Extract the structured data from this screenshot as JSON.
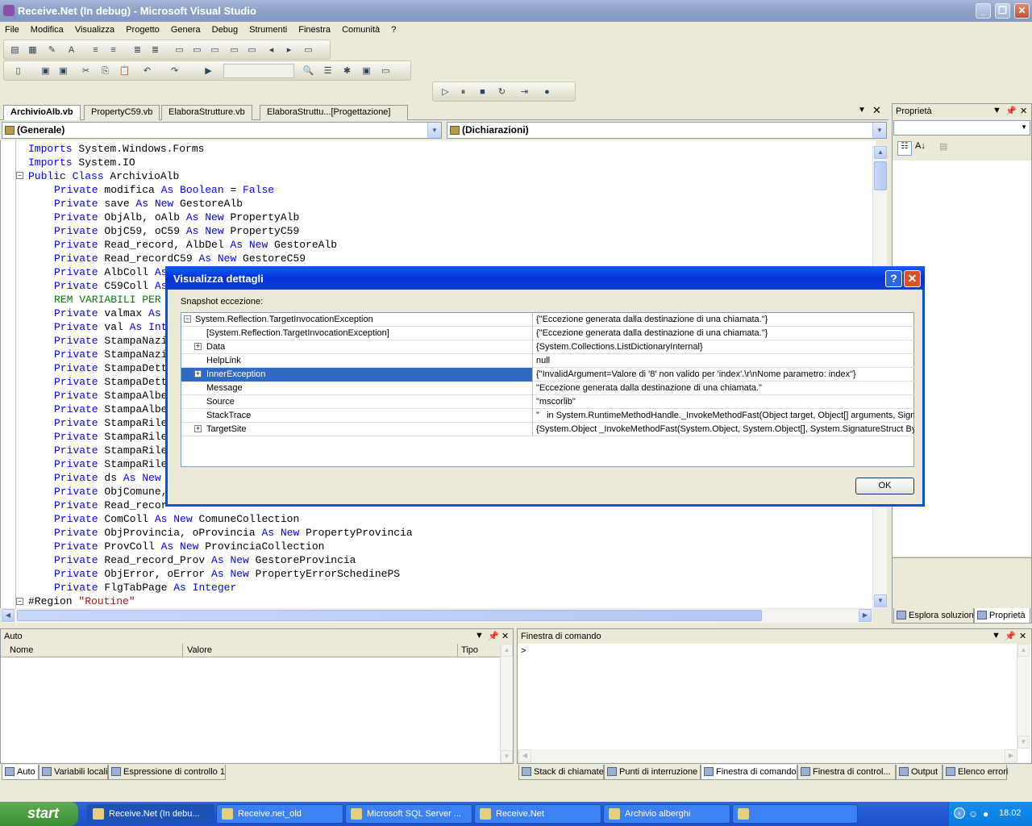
{
  "window": {
    "title": "Receive.Net (In debug) - Microsoft Visual Studio"
  },
  "menu": [
    "File",
    "Modifica",
    "Visualizza",
    "Progetto",
    "Genera",
    "Debug",
    "Strumenti",
    "Finestra",
    "Comunità",
    "?"
  ],
  "doc_tabs": [
    "ArchivioAlb.vb",
    "PropertyC59.vb",
    "ElaboraStrutture.vb",
    "ElaboraStruttu...[Progettazione]"
  ],
  "combos": {
    "left": "(Generale)",
    "right": "(Dichiarazioni)"
  },
  "code": {
    "l1": {
      "kw": "Imports",
      "rest": " System.Windows.Forms"
    },
    "l2": {
      "kw": "Imports",
      "rest": " System.IO"
    },
    "l3": {
      "kw": "Public Class",
      "rest": " ArchivioAlb"
    },
    "l4": {
      "rest1": " modifica ",
      "kw2": "As Boolean",
      "rest2": " = ",
      "kw3": "False"
    },
    "l5": {
      "rest1": " save ",
      "kw2": "As New",
      "rest2": " GestoreAlb"
    },
    "l6": {
      "rest1": " ObjAlb, oAlb ",
      "kw2": "As New",
      "rest2": " PropertyAlb"
    },
    "l7": {
      "rest1": " ObjC59, oC59 ",
      "kw2": "As New",
      "rest2": " PropertyC59"
    },
    "l8": {
      "rest1": " Read_record, AlbDel ",
      "kw2": "As New",
      "rest2": " GestoreAlb"
    },
    "l9": {
      "rest1": " Read_recordC59 ",
      "kw2": "As New",
      "rest2": " GestoreC59"
    },
    "l10": {
      "rest1": " AlbColl ",
      "kw2": "As"
    },
    "l11": {
      "rest1": " C59Coll ",
      "kw2": "As"
    },
    "l12": {
      "cm": "REM VARIABILI PER"
    },
    "l13": {
      "rest1": " valmax ",
      "kw2": "As"
    },
    "l14": {
      "rest1": " val ",
      "kw2": "As Int"
    },
    "l15": {
      "rest1": " StampaNazi"
    },
    "l16": {
      "rest1": " StampaNazi"
    },
    "l17": {
      "rest1": " StampaDett"
    },
    "l18": {
      "rest1": " StampaDett"
    },
    "l19": {
      "rest1": " StampaAlbe"
    },
    "l20": {
      "rest1": " StampaAlbe"
    },
    "l21": {
      "rest1": " StampaRile"
    },
    "l22": {
      "rest1": " StampaRile"
    },
    "l23": {
      "rest1": " StampaRile"
    },
    "l24": {
      "rest1": " StampaRile"
    },
    "l25": {
      "rest1": " ds ",
      "kw2": "As New"
    },
    "l26": {
      "rest1": " ObjComune,"
    },
    "l27": {
      "rest1": " Read_recor"
    },
    "l28": {
      "rest1": " ComColl ",
      "kw2": "As New",
      "rest2": " ComuneCollection"
    },
    "l29": {
      "rest1": " ObjProvincia, oProvincia ",
      "kw2": "As New",
      "rest2": " PropertyProvincia"
    },
    "l30": {
      "rest1": " ProvColl ",
      "kw2": "As New",
      "rest2": " ProvinciaCollection"
    },
    "l31": {
      "rest1": " Read_record_Prov ",
      "kw2": "As New",
      "rest2": " GestoreProvincia"
    },
    "l32": {
      "rest1": " ObjError, oError ",
      "kw2": "As New",
      "rest2": " PropertyErrorSchedinePS"
    },
    "l33": {
      "rest1": " FlgTabPage ",
      "kw2": "As Integer"
    },
    "l34": {
      "rest1": "#Region ",
      "str": "\"Routine\""
    },
    "private": "Private"
  },
  "properties_panel": {
    "title": "Proprietà",
    "tabs": [
      "Esplora soluzioni",
      "Proprietà"
    ]
  },
  "auto_panel": {
    "title": "Auto",
    "columns": [
      "Nome",
      "Valore",
      "Tipo"
    ]
  },
  "command_panel": {
    "title": "Finestra di comando",
    "prompt": ">"
  },
  "bottom_left_tabs": [
    "Auto",
    "Variabili locali",
    "Espressione di controllo 1"
  ],
  "bottom_right_tabs": [
    "Stack di chiamate",
    "Punti di interruzione",
    "Finestra di comando",
    "Finestra di control...",
    "Output",
    "Elenco errori"
  ],
  "dialog": {
    "title": "Visualizza dettagli",
    "label": "Snapshot eccezione:",
    "rows": [
      {
        "name": "System.Reflection.TargetInvocationException",
        "value": "{\"Eccezione generata dalla destinazione di una chiamata.\"}"
      },
      {
        "name": "[System.Reflection.TargetInvocationException]",
        "value": "{\"Eccezione generata dalla destinazione di una chiamata.\"}"
      },
      {
        "name": "Data",
        "value": "{System.Collections.ListDictionaryInternal}"
      },
      {
        "name": "HelpLink",
        "value": "null"
      },
      {
        "name": "InnerException",
        "value": "{\"InvalidArgument=Valore di '8' non valido per 'index'.\\r\\nNome parametro: index\"}"
      },
      {
        "name": "Message",
        "value": "\"Eccezione generata dalla destinazione di una chiamata.\""
      },
      {
        "name": "Source",
        "value": "\"mscorlib\""
      },
      {
        "name": "StackTrace",
        "value": "\"   in System.RuntimeMethodHandle._InvokeMethodFast(Object target, Object[] arguments, Signa"
      },
      {
        "name": "TargetSite",
        "value": "{System.Object _InvokeMethodFast(System.Object, System.Object[], System.SignatureStruct By"
      }
    ],
    "ok_label": "OK"
  },
  "taskbar": {
    "start": "start",
    "tasks": [
      "Receive.Net (In debu...",
      "Receive.net_old",
      "Microsoft SQL Server ...",
      "Receive.Net",
      "Archivio alberghi",
      ""
    ],
    "clock": "18.02"
  }
}
